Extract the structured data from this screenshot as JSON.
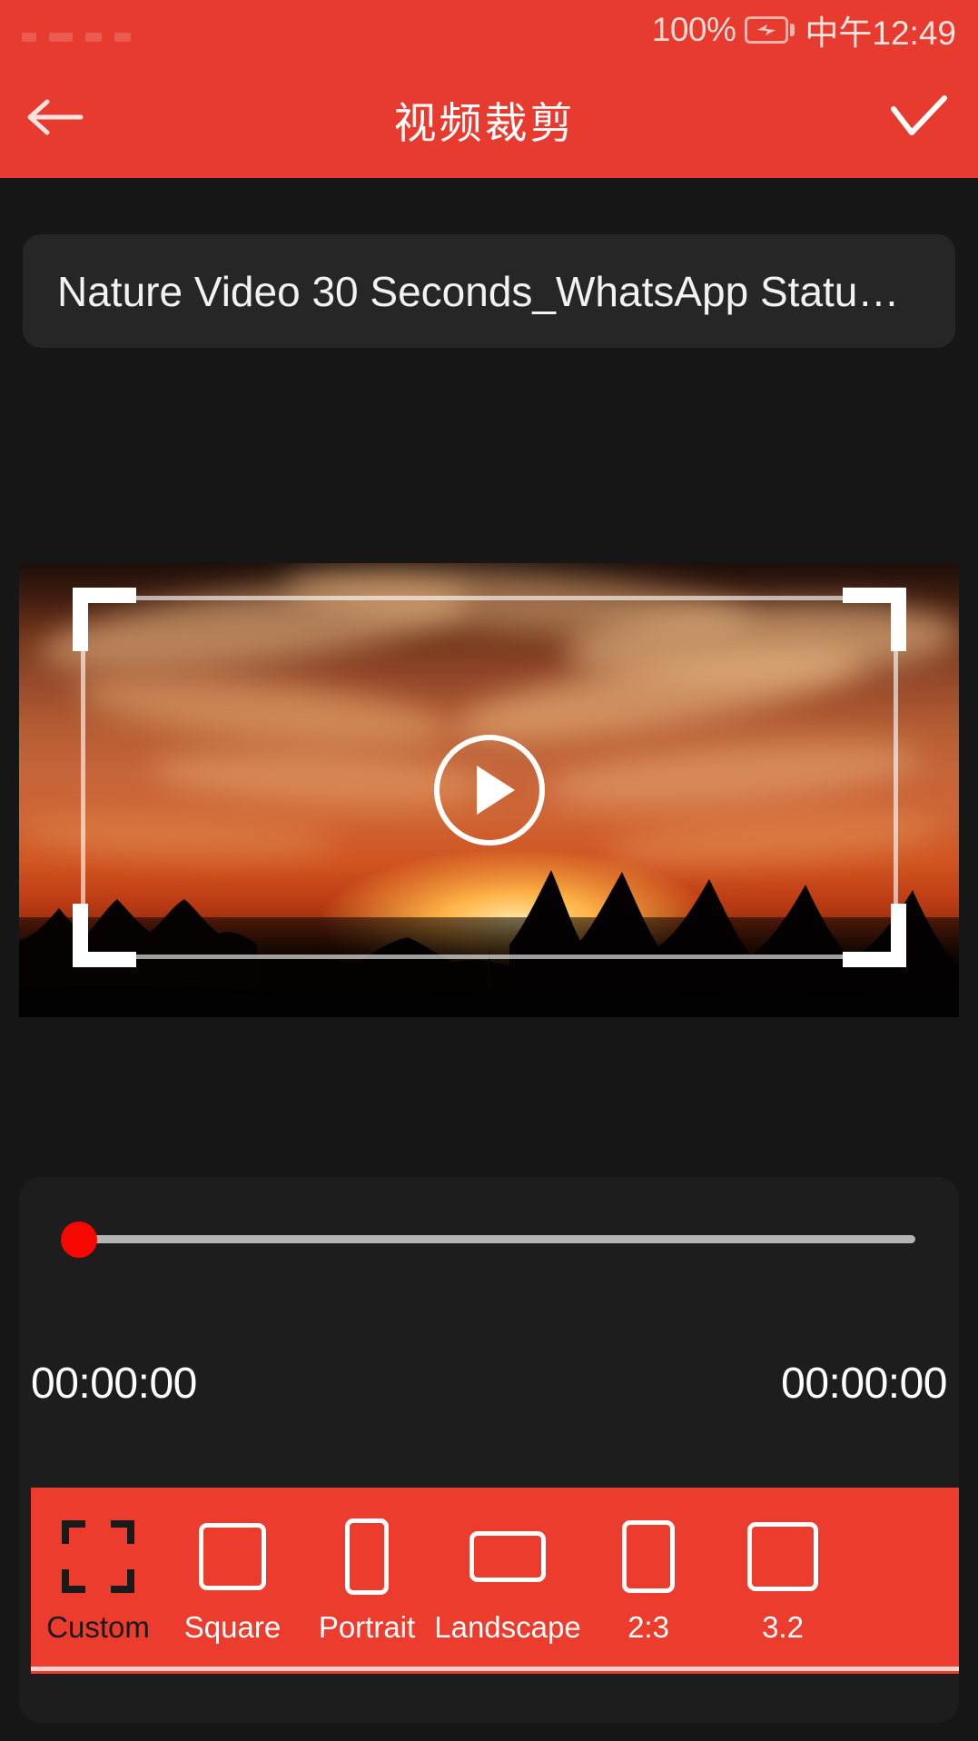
{
  "theme": {
    "brand_red": "#e63b2e",
    "toolbar_red": "#ec3c2d",
    "page_bg": "#161616",
    "card_bg": "#262626",
    "bottom_card_bg": "#1d1d1d",
    "slider_thumb": "#f60800",
    "track": "#b4b4b4",
    "selected_label": "#1a1a1a"
  },
  "status_bar": {
    "battery_percent": "100%",
    "battery_icon": "battery-charging-icon",
    "time": "中午12:49",
    "notification_icons": [
      "notif-dot-1",
      "notif-dot-2",
      "notif-dot-3",
      "notif-dot-4"
    ]
  },
  "app_bar": {
    "back_icon": "arrow-left-icon",
    "title": "视频裁剪",
    "done_icon": "check-icon"
  },
  "filename": {
    "value": "Nature Video 30 Seconds_WhatsApp Statu…"
  },
  "preview": {
    "play_icon": "play-circle-icon",
    "crop_frame": {
      "handles": [
        "top-left",
        "top-right",
        "bottom-left",
        "bottom-right"
      ]
    },
    "scene_description": "sunset sky with tree silhouettes"
  },
  "trim": {
    "slider_icon": "slider-thumb",
    "slider_value_percent": 0,
    "start_time": "00:00:00",
    "end_time": "00:00:00"
  },
  "ratio_bar": {
    "items": [
      {
        "label": "Custom",
        "icon": "crop-corners-icon",
        "selected": true
      },
      {
        "label": "Square",
        "icon": "square-icon",
        "selected": false
      },
      {
        "label": "Portrait",
        "icon": "portrait-rect-icon",
        "selected": false
      },
      {
        "label": "Landscape",
        "icon": "landscape-rect-icon",
        "selected": false
      },
      {
        "label": "2:3",
        "icon": "ratio-2-3-icon",
        "selected": false
      },
      {
        "label": "3.2",
        "icon": "ratio-3-2-icon",
        "selected": false
      }
    ]
  }
}
